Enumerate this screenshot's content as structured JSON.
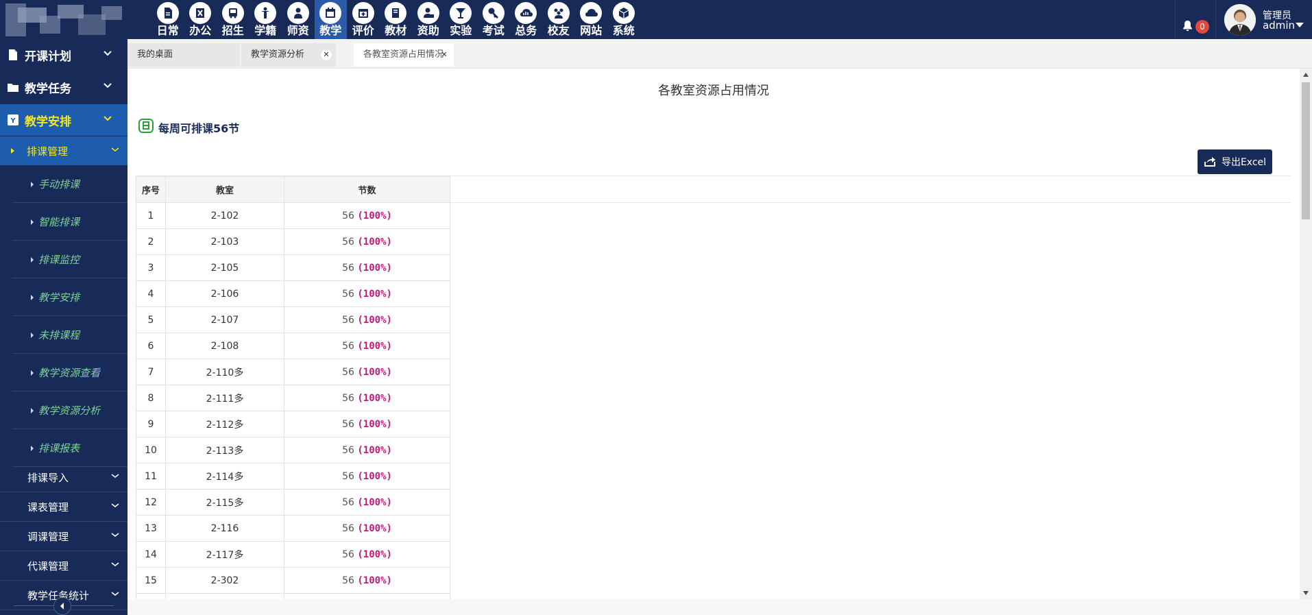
{
  "topnav": {
    "items": [
      {
        "label": "日常",
        "icon": "document-icon"
      },
      {
        "label": "办公",
        "icon": "x-app-icon"
      },
      {
        "label": "招生",
        "icon": "bus-icon"
      },
      {
        "label": "学籍",
        "icon": "person-icon"
      },
      {
        "label": "师资",
        "icon": "teacher-icon"
      },
      {
        "label": "教学",
        "icon": "calendar-icon",
        "active": true
      },
      {
        "label": "评价",
        "icon": "calendar-plus-icon"
      },
      {
        "label": "教材",
        "icon": "book-icon"
      },
      {
        "label": "资助",
        "icon": "user-lock-icon"
      },
      {
        "label": "实验",
        "icon": "glass-icon"
      },
      {
        "label": "考试",
        "icon": "key-icon"
      },
      {
        "label": "总务",
        "icon": "cloud-chart-icon"
      },
      {
        "label": "校友",
        "icon": "users-icon"
      },
      {
        "label": "网站",
        "icon": "cloud-icon"
      },
      {
        "label": "系统",
        "icon": "cube-icon"
      }
    ],
    "active_color": "#2a5ba8"
  },
  "header": {
    "notification_count": "0",
    "user_role": "管理员",
    "user_name": "admin"
  },
  "sidebar": {
    "top_menus": [
      {
        "label": "开课计划",
        "icon": "file-icon"
      },
      {
        "label": "教学任务",
        "icon": "folder-icon"
      },
      {
        "label": "教学安排",
        "icon": "y-badge-icon",
        "active": true
      }
    ],
    "sub_active": "排课管理",
    "leaves": [
      "手动排课",
      "智能排课",
      "排课监控",
      "教学安排",
      "未排课程",
      "教学资源查看",
      "教学资源分析",
      "排课报表"
    ],
    "sub_menus": [
      "排课导入",
      "课表管理",
      "调课管理",
      "代课管理",
      "教学任务统计"
    ]
  },
  "tabs": [
    {
      "label": "我的桌面"
    },
    {
      "label": "教学资源分析"
    },
    {
      "label": "各教室资源占用情况",
      "active": true
    }
  ],
  "content": {
    "title": "各教室资源占用情况",
    "weekly_info": "每周可排课56节",
    "export_label": "导出Excel",
    "table": {
      "headers": [
        "序号",
        "教室",
        "节数"
      ],
      "rows": [
        {
          "no": "1",
          "room": "2-102",
          "sections": "56",
          "pct": "(100%)"
        },
        {
          "no": "2",
          "room": "2-103",
          "sections": "56",
          "pct": "(100%)"
        },
        {
          "no": "3",
          "room": "2-105",
          "sections": "56",
          "pct": "(100%)"
        },
        {
          "no": "4",
          "room": "2-106",
          "sections": "56",
          "pct": "(100%)"
        },
        {
          "no": "5",
          "room": "2-107",
          "sections": "56",
          "pct": "(100%)"
        },
        {
          "no": "6",
          "room": "2-108",
          "sections": "56",
          "pct": "(100%)"
        },
        {
          "no": "7",
          "room": "2-110多",
          "sections": "56",
          "pct": "(100%)"
        },
        {
          "no": "8",
          "room": "2-111多",
          "sections": "56",
          "pct": "(100%)"
        },
        {
          "no": "9",
          "room": "2-112多",
          "sections": "56",
          "pct": "(100%)"
        },
        {
          "no": "10",
          "room": "2-113多",
          "sections": "56",
          "pct": "(100%)"
        },
        {
          "no": "11",
          "room": "2-114多",
          "sections": "56",
          "pct": "(100%)"
        },
        {
          "no": "12",
          "room": "2-115多",
          "sections": "56",
          "pct": "(100%)"
        },
        {
          "no": "13",
          "room": "2-116",
          "sections": "56",
          "pct": "(100%)"
        },
        {
          "no": "14",
          "room": "2-117多",
          "sections": "56",
          "pct": "(100%)"
        },
        {
          "no": "15",
          "room": "2-302",
          "sections": "56",
          "pct": "(100%)"
        },
        {
          "no": "",
          "room": "",
          "sections": "",
          "pct": ""
        }
      ]
    }
  },
  "colors": {
    "navy": "#182a57",
    "sidebar_active": "#1e5cae",
    "active_text": "#f5e81c",
    "leaf_text": "#7ed19a",
    "percent": "#c5177a",
    "badge": "#e04a3c"
  }
}
